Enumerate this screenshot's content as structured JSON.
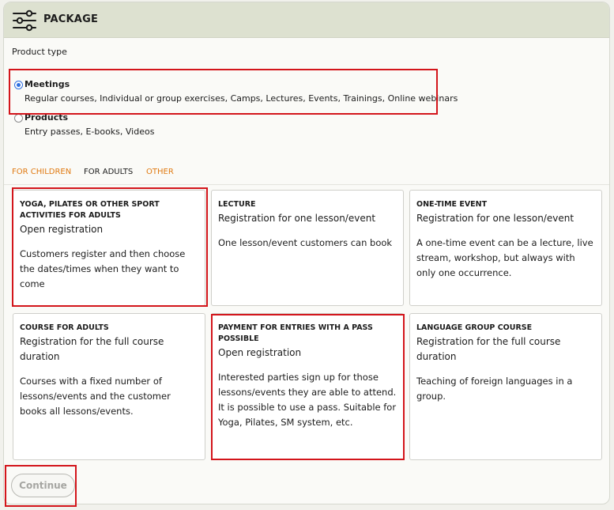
{
  "header": {
    "title": "PACKAGE",
    "icon": "sliders-icon"
  },
  "product_type_label": "Product type",
  "product_types": [
    {
      "title": "Meetings",
      "desc": "Regular courses, Individual or group exercises, Camps, Lectures, Events, Trainings, Online webinars",
      "checked": true
    },
    {
      "title": "Products",
      "desc": "Entry passes, E-books, Videos",
      "checked": false
    }
  ],
  "tabs": [
    {
      "label": "FOR CHILDREN",
      "active": false
    },
    {
      "label": "FOR ADULTS",
      "active": true
    },
    {
      "label": "OTHER",
      "active": false
    }
  ],
  "cards": [
    {
      "title": "YOGA, PILATES OR OTHER SPORT ACTIVITIES FOR ADULTS",
      "subtitle": "Open registration",
      "desc": "Customers register and then choose the dates/times when they want to come",
      "highlighted": true
    },
    {
      "title": "LECTURE",
      "subtitle": "Registration for one lesson/event",
      "desc": "One lesson/event customers can book",
      "highlighted": false
    },
    {
      "title": "ONE-TIME EVENT",
      "subtitle": "Registration for one lesson/event",
      "desc": "A one-time event can be a lecture, live stream, workshop, but always with only one occurrence.",
      "highlighted": false
    },
    {
      "title": "COURSE FOR ADULTS",
      "subtitle": "Registration for the full course duration",
      "desc": "Courses with a fixed number of lessons/events and the customer books all lessons/events.",
      "highlighted": false
    },
    {
      "title": "PAYMENT FOR ENTRIES WITH A PASS POSSIBLE",
      "subtitle": "Open registration",
      "desc": "Interested parties sign up for those lessons/events they are able to attend. It is possible to use a pass. Suitable for Yoga, Pilates, SM system, etc.",
      "highlighted": true
    },
    {
      "title": "LANGUAGE GROUP COURSE",
      "subtitle": "Registration for the full course duration",
      "desc": "Teaching of foreign languages in a group.",
      "highlighted": false
    }
  ],
  "continue_label": "Continue",
  "colors": {
    "header_bg": "#dde1d0",
    "accent_orange": "#e07a12",
    "highlight_red": "#d3151b",
    "radio_blue": "#2f6fe0"
  }
}
